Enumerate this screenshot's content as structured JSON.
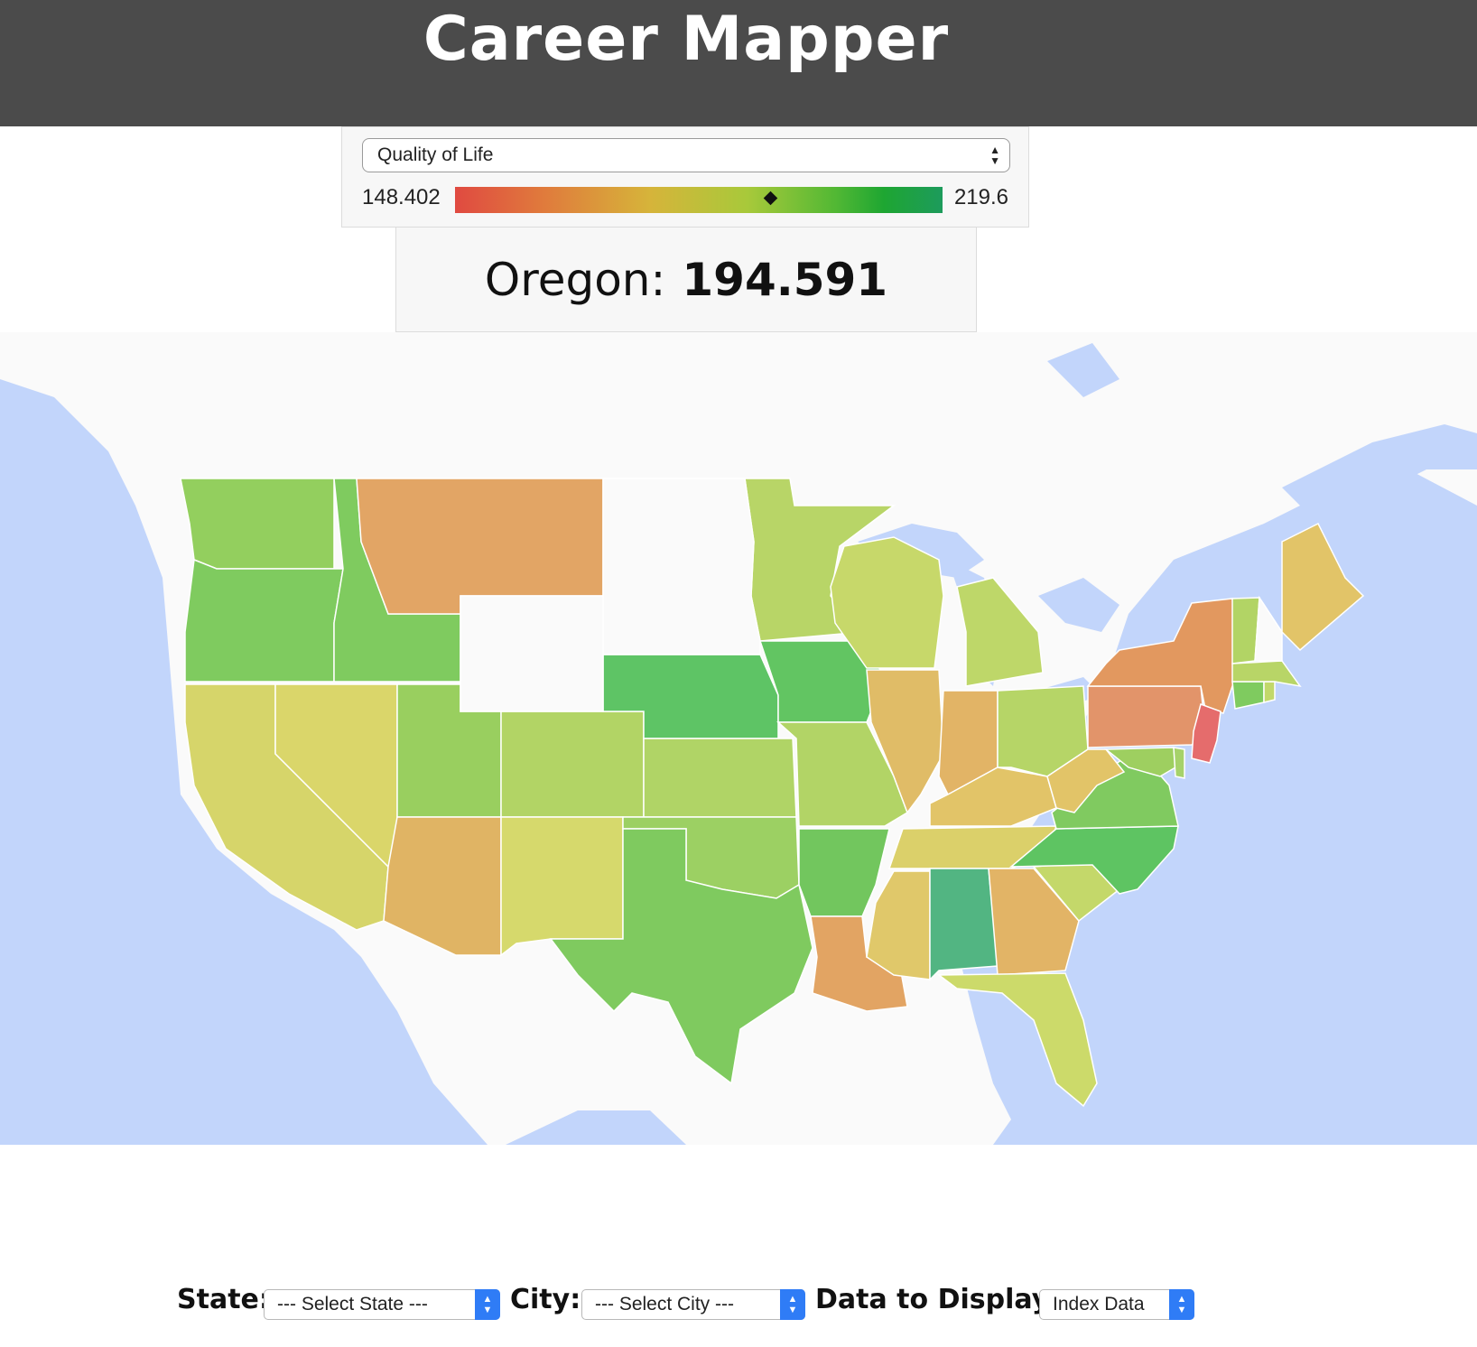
{
  "header": {
    "title": "Career Mapper"
  },
  "metric_selector": {
    "selected": "Quality of Life"
  },
  "scale": {
    "min": 148.402,
    "max": 219.6,
    "min_label": "148.402",
    "max_label": "219.6",
    "marker_value": 194.591
  },
  "readout": {
    "state": "Oregon:",
    "value": "194.591"
  },
  "controls": {
    "state_label": "State:",
    "state_select": "--- Select State ---",
    "city_label": "City:",
    "city_select": "--- Select City ---",
    "data_label": "Data to Display:",
    "data_select": "Index Data"
  },
  "map_data": {
    "type": "choropleth",
    "colors": {
      "water": "#c2d5fb",
      "land": "#fafafa",
      "border": "#ffffff"
    },
    "states": [
      {
        "name": "Washington",
        "color": "#93cf5e"
      },
      {
        "name": "Oregon",
        "color": "#7fcb5f"
      },
      {
        "name": "Idaho",
        "color": "#7fcb5f"
      },
      {
        "name": "Montana",
        "color": "#e2a565"
      },
      {
        "name": "California",
        "color": "#d6d56a"
      },
      {
        "name": "Nevada",
        "color": "#dad66a"
      },
      {
        "name": "Utah",
        "color": "#99cf5f"
      },
      {
        "name": "Arizona",
        "color": "#e0b464"
      },
      {
        "name": "Colorado",
        "color": "#b2d465"
      },
      {
        "name": "New Mexico",
        "color": "#d6d96c"
      },
      {
        "name": "Nebraska",
        "color": "#5ec465"
      },
      {
        "name": "Kansas",
        "color": "#b0d466"
      },
      {
        "name": "Oklahoma",
        "color": "#9cd063"
      },
      {
        "name": "Texas",
        "color": "#7fca5f"
      },
      {
        "name": "Minnesota",
        "color": "#b8d567"
      },
      {
        "name": "Iowa",
        "color": "#62c562"
      },
      {
        "name": "Missouri",
        "color": "#b2d466"
      },
      {
        "name": "Arkansas",
        "color": "#72c65e"
      },
      {
        "name": "Louisiana",
        "color": "#e2a463"
      },
      {
        "name": "Wisconsin",
        "color": "#c7d86a"
      },
      {
        "name": "Illinois",
        "color": "#e0bc67"
      },
      {
        "name": "Michigan",
        "color": "#bed769"
      },
      {
        "name": "Indiana",
        "color": "#e2b466"
      },
      {
        "name": "Ohio",
        "color": "#b6d567"
      },
      {
        "name": "Kentucky",
        "color": "#e2c468"
      },
      {
        "name": "Tennessee",
        "color": "#dbd06a"
      },
      {
        "name": "Mississippi",
        "color": "#e0c86a"
      },
      {
        "name": "Alabama",
        "color": "#52b582"
      },
      {
        "name": "Georgia",
        "color": "#e2b466"
      },
      {
        "name": "Florida",
        "color": "#ccda6a"
      },
      {
        "name": "South Carolina",
        "color": "#c4d86a"
      },
      {
        "name": "North Carolina",
        "color": "#5ec462"
      },
      {
        "name": "Virginia",
        "color": "#80ca60"
      },
      {
        "name": "West Virginia",
        "color": "#e2c468"
      },
      {
        "name": "Pennsylvania",
        "color": "#e2946a"
      },
      {
        "name": "New York",
        "color": "#e2985f"
      },
      {
        "name": "New Jersey",
        "color": "#e56c6c"
      },
      {
        "name": "Maryland",
        "color": "#9ecf60"
      },
      {
        "name": "Delaware",
        "color": "#a6d26a"
      },
      {
        "name": "Connecticut",
        "color": "#7fcb5f"
      },
      {
        "name": "Rhode Island",
        "color": "#c2d86a"
      },
      {
        "name": "Massachusetts",
        "color": "#b8d567"
      },
      {
        "name": "Vermont",
        "color": "#b2d465"
      },
      {
        "name": "New Hampshire",
        "color": "#fafafa"
      },
      {
        "name": "Maine",
        "color": "#e2c468"
      }
    ]
  }
}
